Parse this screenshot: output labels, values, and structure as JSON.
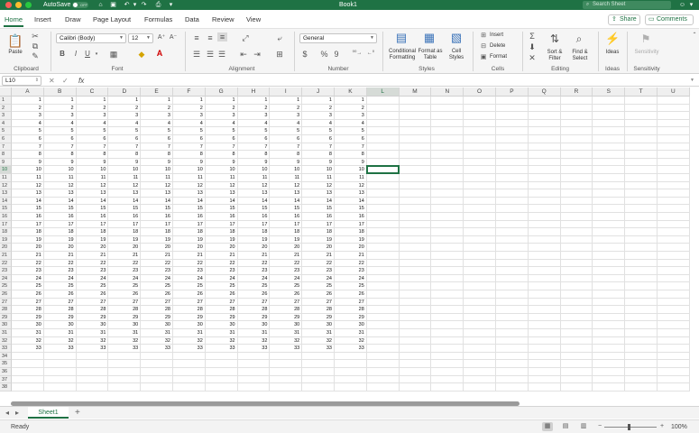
{
  "window": {
    "title": "Book1",
    "autosave_label": "AutoSave",
    "autosave_state": "OFF",
    "search_placeholder": "Search Sheet",
    "traffic_colors": [
      "#fe5f57",
      "#febc2e",
      "#28c840"
    ]
  },
  "tabs": [
    "Home",
    "Insert",
    "Draw",
    "Page Layout",
    "Formulas",
    "Data",
    "Review",
    "View"
  ],
  "actions": {
    "share": "Share",
    "comments": "Comments"
  },
  "ribbon": {
    "clipboard": {
      "label": "Clipboard",
      "paste": "Paste"
    },
    "font": {
      "label": "Font",
      "family": "Calibri (Body)",
      "size": "12",
      "bold": "B",
      "italic": "I",
      "underline": "U"
    },
    "alignment": {
      "label": "Alignment"
    },
    "number": {
      "label": "Number",
      "format": "General",
      "currency": "$",
      "percent": "%",
      "comma": "9"
    },
    "styles": {
      "label": "Styles",
      "conditional": "Conditional Formatting",
      "format_table": "Format as Table",
      "cell_styles": "Cell Styles"
    },
    "cells": {
      "label": "Cells",
      "insert": "Insert",
      "delete": "Delete",
      "format": "Format"
    },
    "editing": {
      "label": "Editing",
      "sort_filter": "Sort & Filter",
      "find_select": "Find & Select"
    },
    "ideas": {
      "label": "Ideas",
      "button": "Ideas"
    },
    "sensitivity": {
      "label": "Sensitivity",
      "button": "Sensitivity"
    }
  },
  "formula_bar": {
    "name_box": "L10",
    "fx": "fx",
    "content": ""
  },
  "sheet": {
    "columns": [
      "A",
      "B",
      "C",
      "D",
      "E",
      "F",
      "G",
      "H",
      "I",
      "J",
      "K",
      "L",
      "M",
      "N",
      "O",
      "P",
      "Q",
      "R",
      "S",
      "T",
      "U"
    ],
    "row_count": 38,
    "filled_columns": 11,
    "filled_rows": 33,
    "selected_cell": "L10"
  },
  "sheet_tabs": [
    "Sheet1"
  ],
  "status": {
    "text": "Ready",
    "zoom": "100%"
  }
}
